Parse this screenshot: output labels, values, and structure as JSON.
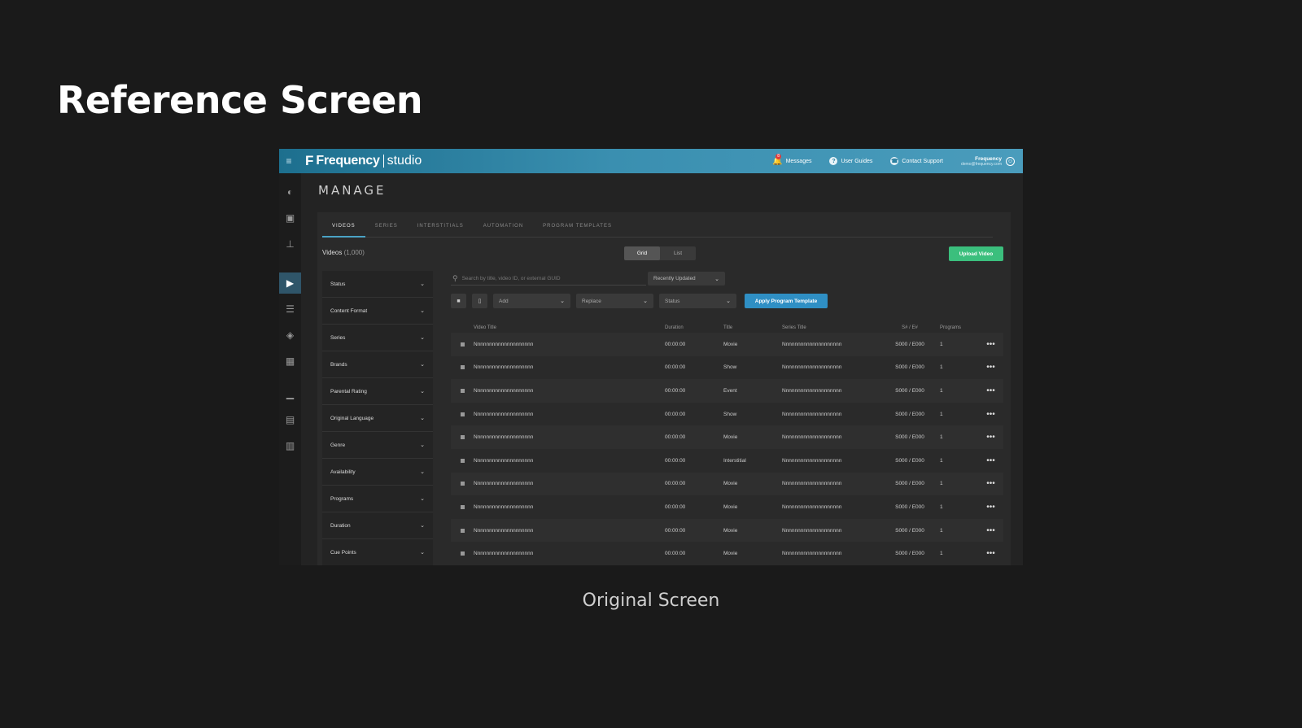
{
  "slide": {
    "title": "Reference Screen",
    "caption": "Original Screen"
  },
  "topbar": {
    "menu_icon": "≡",
    "logo_mark": "F",
    "logo_name": "Frequency",
    "logo_studio": "studio",
    "messages": "Messages",
    "messages_badge": "8",
    "user_guides": "User Guides",
    "contact_support": "Contact Support",
    "user_name": "Frequency",
    "user_email": "demo@frequency.com"
  },
  "page": {
    "title": "MANAGE"
  },
  "tabs": [
    "VIDEOS",
    "SERIES",
    "INTERSTITIALS",
    "AUTOMATION",
    "PROGRAM TEMPLATES"
  ],
  "videos": {
    "label": "Videos",
    "count": "(1,000)"
  },
  "view_toggle": {
    "grid": "Grid",
    "list": "List"
  },
  "upload_button": "Upload Video",
  "filters": [
    "Status",
    "Content Format",
    "Series",
    "Brands",
    "Parental Rating",
    "Original Language",
    "Genre",
    "Availability",
    "Programs",
    "Duration",
    "Cue Points"
  ],
  "search": {
    "placeholder": "Search by title, video ID, or external GUID"
  },
  "sort": {
    "value": "Recently Updated"
  },
  "toolbar": {
    "add": "Add",
    "replace": "Replace",
    "status": "Status",
    "apply": "Apply Program Template"
  },
  "table": {
    "headers": {
      "title": "Video Title",
      "duration": "Duration",
      "type": "Title",
      "series": "Series Title",
      "se": "S# / E#",
      "programs": "Programs"
    },
    "rows": [
      {
        "title": "Nnnnnnnnnnnnnnnnnnnn",
        "duration": "00:00:00",
        "type": "Movie",
        "series": "Nnnnnnnnnnnnnnnnnnnn",
        "se": "S000 / E000",
        "programs": "1"
      },
      {
        "title": "Nnnnnnnnnnnnnnnnnnnn",
        "duration": "00:00:00",
        "type": "Show",
        "series": "Nnnnnnnnnnnnnnnnnnnn",
        "se": "S000 / E000",
        "programs": "1"
      },
      {
        "title": "Nnnnnnnnnnnnnnnnnnnn",
        "duration": "00:00:00",
        "type": "Event",
        "series": "Nnnnnnnnnnnnnnnnnnnn",
        "se": "S000 / E000",
        "programs": "1"
      },
      {
        "title": "Nnnnnnnnnnnnnnnnnnnn",
        "duration": "00:00:00",
        "type": "Show",
        "series": "Nnnnnnnnnnnnnnnnnnnn",
        "se": "S000 / E000",
        "programs": "1"
      },
      {
        "title": "Nnnnnnnnnnnnnnnnnnnn",
        "duration": "00:00:00",
        "type": "Movie",
        "series": "Nnnnnnnnnnnnnnnnnnnn",
        "se": "S000 / E000",
        "programs": "1"
      },
      {
        "title": "Nnnnnnnnnnnnnnnnnnnn",
        "duration": "00:00:00",
        "type": "Interstitial",
        "series": "Nnnnnnnnnnnnnnnnnnnn",
        "se": "S000 / E000",
        "programs": "1"
      },
      {
        "title": "Nnnnnnnnnnnnnnnnnnnn",
        "duration": "00:00:00",
        "type": "Movie",
        "series": "Nnnnnnnnnnnnnnnnnnnn",
        "se": "S000 / E000",
        "programs": "1"
      },
      {
        "title": "Nnnnnnnnnnnnnnnnnnnn",
        "duration": "00:00:00",
        "type": "Movie",
        "series": "Nnnnnnnnnnnnnnnnnnnn",
        "se": "S000 / E000",
        "programs": "1"
      },
      {
        "title": "Nnnnnnnnnnnnnnnnnnnn",
        "duration": "00:00:00",
        "type": "Movie",
        "series": "Nnnnnnnnnnnnnnnnnnnn",
        "se": "S000 / E000",
        "programs": "1"
      },
      {
        "title": "Nnnnnnnnnnnnnnnnnnnn",
        "duration": "00:00:00",
        "type": "Movie",
        "series": "Nnnnnnnnnnnnnnnnnnnn",
        "se": "S000 / E000",
        "programs": "1"
      }
    ]
  },
  "sidebar_icons": [
    "dashboard-icon",
    "monitor-icon",
    "broadcast-icon",
    "video-library-icon",
    "schedule-icon",
    "layers-icon",
    "calendar-icon",
    "analytics-icon",
    "user-card-icon",
    "reports-icon"
  ],
  "colors": {
    "topbar": "#3a8fb0",
    "accent": "#2f8fc4",
    "upload": "#3bbf7d",
    "active_side": "#2f5569"
  }
}
